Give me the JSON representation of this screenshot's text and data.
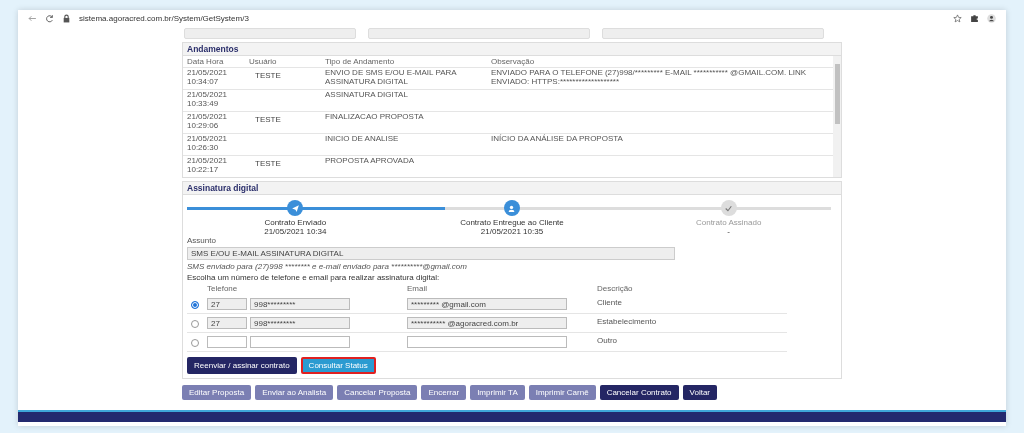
{
  "browser": {
    "url": "sistema.agoracred.com.br/System/GetSystem/3"
  },
  "andamentos": {
    "title": "Andamentos",
    "columns": [
      "Data Hora",
      "Usuário",
      "Tipo de Andamento",
      "Observação"
    ],
    "rows": [
      {
        "date": "21/05/2021\n10:34:07",
        "user": "TESTE",
        "type": "ENVIO DE SMS E/OU E-MAIL PARA ASSINATURA DIGITAL",
        "obs": "ENVIADO PARA O TELEFONE (27)998/********* E-MAIL *********** @GMAIL.COM. LINK ENVIADO: HTTPS:*******************"
      },
      {
        "date": "21/05/2021\n10:33:49",
        "type": "ASSINATURA DIGITAL"
      },
      {
        "date": "21/05/2021\n10:29:06",
        "user": "TESTE",
        "type": "FINALIZACAO PROPOSTA"
      },
      {
        "date": "21/05/2021\n10:26:30",
        "type": "INICIO DE ANALISE",
        "obs": "INÍCIO DA ANÁLISE DA PROPOSTA"
      },
      {
        "date": "21/05/2021\n10:22:17",
        "user": "TESTE",
        "type": "PROPOSTA APROVADA"
      }
    ]
  },
  "assinatura": {
    "title": "Assinatura digital",
    "steps": [
      {
        "label": "Contrato Enviado",
        "date": "21/05/2021 10:34",
        "done": true
      },
      {
        "label": "Contrato Entregue ao Cliente",
        "date": "21/05/2021 10:35",
        "done": true
      },
      {
        "label": "Contrato Assinado",
        "date": "-",
        "done": false
      }
    ],
    "assunto_label": "Assunto",
    "assunto": "SMS E/OU E-MAIL ASSINATURA DIGITAL",
    "sent_note": "SMS enviado para (27)998 ******** e e-mail enviado para **********@gmail.com",
    "choose_label": "Escolha um número de telefone e email para realizar assinatura digital:",
    "columns": [
      "Telefone",
      "Email",
      "Descrição"
    ],
    "contacts": [
      {
        "kind": "saved",
        "selected": true,
        "ddd": "27",
        "phone": "998*********",
        "email": "********* @gmail.com",
        "desc": "Cliente"
      },
      {
        "kind": "saved",
        "selected": false,
        "ddd": "27",
        "phone": "998*********",
        "email": "*********** @agoracred.com.br",
        "desc": "Estabelecimento"
      },
      {
        "kind": "blank",
        "selected": false,
        "desc": "Outro"
      }
    ],
    "buttons": [
      {
        "label": "Reenviar / assinar contrato",
        "kind": "primary",
        "highlighted": false
      },
      {
        "label": "Consultar Status",
        "kind": "info",
        "highlighted": true
      }
    ]
  },
  "actions": [
    {
      "label": "Editar Proposta",
      "disabled": true
    },
    {
      "label": "Enviar ao Analista",
      "disabled": true
    },
    {
      "label": "Cancelar Proposta",
      "disabled": true
    },
    {
      "label": "Encerrar",
      "disabled": true
    },
    {
      "label": "Imprimir TA",
      "disabled": true
    },
    {
      "label": "Imprimir Carnê",
      "disabled": true
    },
    {
      "label": "Cancelar Contrato",
      "disabled": false
    },
    {
      "label": "Voltar",
      "disabled": false
    }
  ]
}
